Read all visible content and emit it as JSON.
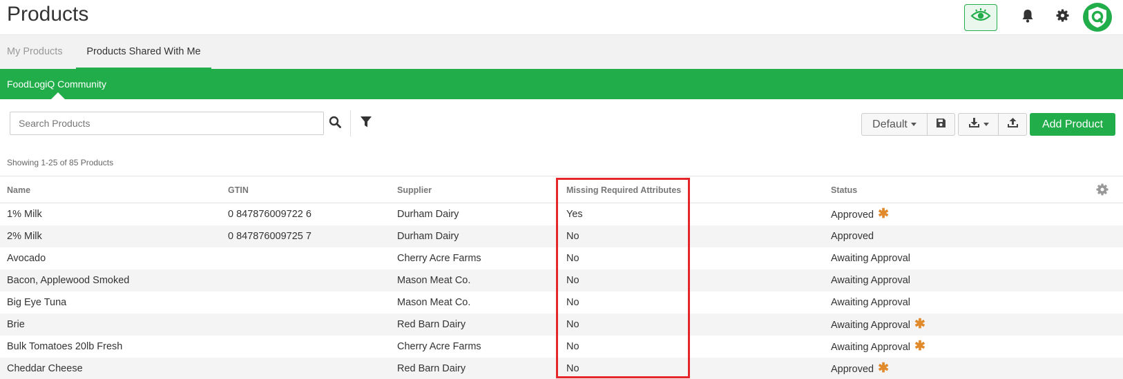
{
  "header": {
    "title": "Products",
    "icons": [
      "eye-icon",
      "bell-icon",
      "gear-icon",
      "app-logo"
    ]
  },
  "tabs": [
    {
      "label": "My Products",
      "active": false
    },
    {
      "label": "Products Shared With Me",
      "active": true
    }
  ],
  "community": {
    "label": "FoodLogiQ Community"
  },
  "toolbar": {
    "search_placeholder": "Search Products",
    "view_label": "Default",
    "add_label": "Add Product"
  },
  "showing_text": "Showing 1-25 of 85 Products",
  "table": {
    "columns": [
      "Name",
      "GTIN",
      "Supplier",
      "Missing Required Attributes",
      "Status"
    ],
    "rows": [
      {
        "name": "1% Milk",
        "gtin": "0 847876009722 6",
        "supplier": "Durham Dairy",
        "missing": "Yes",
        "status": "Approved",
        "flag": true
      },
      {
        "name": "2% Milk",
        "gtin": "0 847876009725 7",
        "supplier": "Durham Dairy",
        "missing": "No",
        "status": "Approved",
        "flag": false
      },
      {
        "name": "Avocado",
        "gtin": "",
        "supplier": "Cherry Acre Farms",
        "missing": "No",
        "status": "Awaiting Approval",
        "flag": false
      },
      {
        "name": "Bacon, Applewood Smoked",
        "gtin": "",
        "supplier": "Mason Meat Co.",
        "missing": "No",
        "status": "Awaiting Approval",
        "flag": false
      },
      {
        "name": "Big Eye Tuna",
        "gtin": "",
        "supplier": "Mason Meat Co.",
        "missing": "No",
        "status": "Awaiting Approval",
        "flag": false
      },
      {
        "name": "Brie",
        "gtin": "",
        "supplier": "Red Barn Dairy",
        "missing": "No",
        "status": "Awaiting Approval",
        "flag": true
      },
      {
        "name": "Bulk Tomatoes 20lb Fresh",
        "gtin": "",
        "supplier": "Cherry Acre Farms",
        "missing": "No",
        "status": "Awaiting Approval",
        "flag": true
      },
      {
        "name": "Cheddar Cheese",
        "gtin": "",
        "supplier": "Red Barn Dairy",
        "missing": "No",
        "status": "Approved",
        "flag": true
      }
    ]
  },
  "colors": {
    "brand_green": "#22ad4b",
    "highlight_red": "#e4252a",
    "flag_orange": "#e08a2c"
  }
}
